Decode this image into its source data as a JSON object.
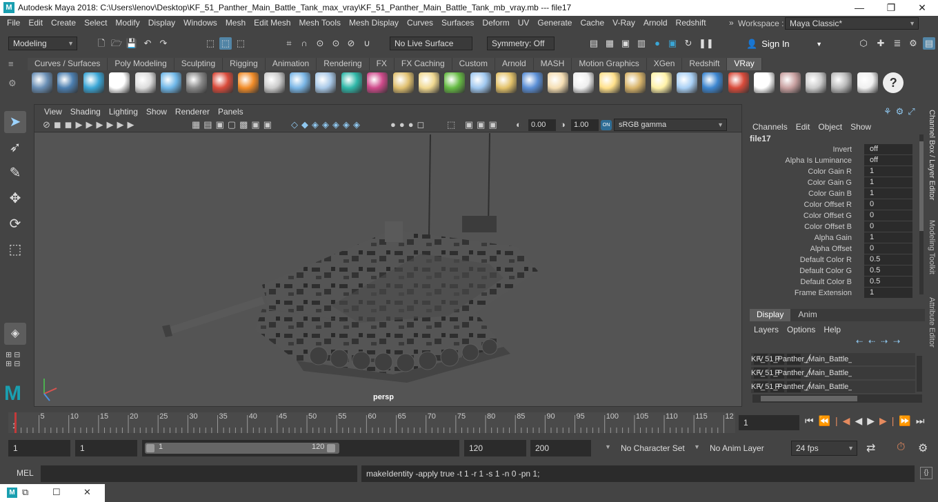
{
  "window": {
    "title": "Autodesk Maya 2018: C:\\Users\\lenov\\Desktop\\KF_51_Panther_Main_Battle_Tank_max_vray\\KF_51_Panther_Main_Battle_Tank_mb_vray.mb   ---   file17",
    "logo": "M",
    "minimize": "—",
    "maximize": "❐",
    "close": "✕"
  },
  "menubar": {
    "items": [
      "File",
      "Edit",
      "Create",
      "Select",
      "Modify",
      "Display",
      "Windows",
      "Mesh",
      "Edit Mesh",
      "Mesh Tools",
      "Mesh Display",
      "Curves",
      "Surfaces",
      "Deform",
      "UV",
      "Generate",
      "Cache",
      "V-Ray",
      "Arnold",
      "Redshift"
    ],
    "overflow": "»",
    "workspace_label": "Workspace :",
    "workspace_value": "Maya Classic*"
  },
  "statusline": {
    "menuset": "Modeling",
    "live_surface": "No Live Surface",
    "symmetry": "Symmetry: Off",
    "sign_in": "Sign In"
  },
  "shelf": {
    "tabs": [
      "Curves / Surfaces",
      "Poly Modeling",
      "Sculpting",
      "Rigging",
      "Animation",
      "Rendering",
      "FX",
      "FX Caching",
      "Custom",
      "Arnold",
      "MASH",
      "Motion Graphics",
      "XGen",
      "Redshift",
      "VRay"
    ],
    "active_tab": "VRay",
    "icons": [
      "vray-settings-icon",
      "vray-frame-buffer-icon",
      "vray-vfb-icon",
      "vray-logo-icon",
      "vray-log-icon",
      "vray-sphere-light-icon",
      "vray-camera-icon",
      "vray-materials-icon",
      "vray-fire-icon",
      "vray-plane-icon",
      "vray-sphere-icon",
      "vray-mesh-light-icon",
      "vray-dome-icon",
      "vray-fur-icon",
      "vray-proxy-icon",
      "vray-globe-icon",
      "vray-grass-icon",
      "vray-scatter-icon",
      "vray-curve-icon",
      "vray-sphere2-icon",
      "vray-dome-light-icon",
      "vray-spot-light-icon",
      "vray-sun-icon",
      "vray-ies-light-icon",
      "vray-sunlight-icon",
      "vray-rect-light-icon",
      "vray-ball-icon",
      "vray-flag-icon",
      "vray-checker-icon",
      "vray-render-icon",
      "vray-layout-icon",
      "vray-light-lister-icon",
      "vray-cloud-icon",
      "vray-help-icon"
    ]
  },
  "viewport": {
    "menu": [
      "View",
      "Shading",
      "Lighting",
      "Show",
      "Renderer",
      "Panels"
    ],
    "exposure": "0.00",
    "gamma": "1.00",
    "color_space": "sRGB gamma",
    "camera_label": "persp"
  },
  "channelbox": {
    "menu": [
      "Channels",
      "Edit",
      "Object",
      "Show"
    ],
    "node_name": "file17",
    "attributes": [
      {
        "label": "Invert",
        "value": "off"
      },
      {
        "label": "Alpha Is Luminance",
        "value": "off"
      },
      {
        "label": "Color Gain R",
        "value": "1"
      },
      {
        "label": "Color Gain G",
        "value": "1"
      },
      {
        "label": "Color Gain B",
        "value": "1"
      },
      {
        "label": "Color Offset R",
        "value": "0"
      },
      {
        "label": "Color Offset G",
        "value": "0"
      },
      {
        "label": "Color Offset B",
        "value": "0"
      },
      {
        "label": "Alpha Gain",
        "value": "1"
      },
      {
        "label": "Alpha Offset",
        "value": "0"
      },
      {
        "label": "Default Color R",
        "value": "0.5"
      },
      {
        "label": "Default Color G",
        "value": "0.5"
      },
      {
        "label": "Default Color B",
        "value": "0.5"
      },
      {
        "label": "Frame Extension",
        "value": "1"
      }
    ]
  },
  "layereditor": {
    "tabs": [
      "Display",
      "Anim"
    ],
    "menu": [
      "Layers",
      "Options",
      "Help"
    ],
    "layers": [
      {
        "v": "V",
        "p": "P",
        "name": "KF_51_Panther_Main_Battle_"
      },
      {
        "v": "V",
        "p": "P",
        "name": "KF_51_Panther_Main_Battle_"
      },
      {
        "v": "V",
        "p": "P",
        "name": "KF_51_Panther_Main_Battle_"
      }
    ]
  },
  "sidetabs": [
    "Channel Box / Layer Editor",
    "Modeling Toolkit",
    "Attribute Editor"
  ],
  "timeslider": {
    "ticks": [
      "5",
      "10",
      "15",
      "20",
      "25",
      "30",
      "35",
      "40",
      "45",
      "50",
      "55",
      "60",
      "65",
      "70",
      "75",
      "80",
      "85",
      "90",
      "95",
      "100",
      "105",
      "110",
      "115",
      "12"
    ],
    "start_label": "1",
    "current_frame": "1",
    "current_frame_ratio": 0.0
  },
  "rangebar": {
    "start": "1",
    "playback_start": "1",
    "range_start": "1",
    "range_end": "120",
    "playback_end": "120",
    "end": "200",
    "character_set": "No Character Set",
    "anim_layer": "No Anim Layer",
    "fps": "24 fps"
  },
  "cmdline": {
    "label": "MEL",
    "result": "makeIdentity -apply true -t 1 -r 1 -s 1 -n 0 -pn 1;"
  },
  "colors": {
    "accent": "#5285a6",
    "panel": "#444444",
    "field": "#2b2b2b",
    "keyframe": "#c53a3a"
  }
}
